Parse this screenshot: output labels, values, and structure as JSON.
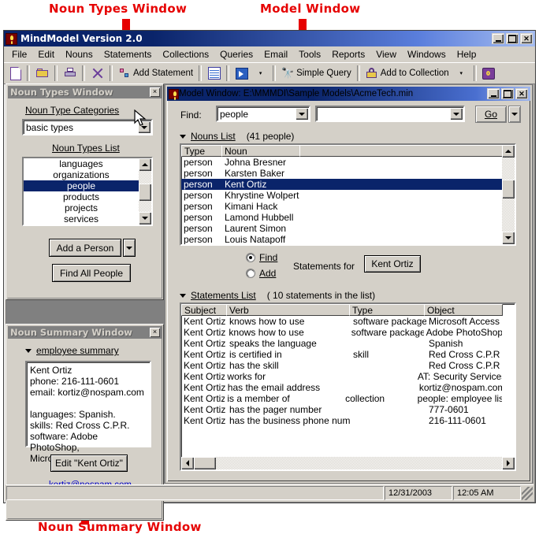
{
  "annotations": [
    {
      "text": "Noun Types Window",
      "name": "callout-noun-types-window"
    },
    {
      "text": "Model Window",
      "name": "callout-model-window"
    },
    {
      "text": "Noun Summary Window",
      "name": "callout-noun-summary-window"
    }
  ],
  "app": {
    "title": "MindModel Version 2.0",
    "minimize": "_",
    "maximize": "□",
    "close": "×",
    "menu": [
      "File",
      "Edit",
      "Nouns",
      "Statements",
      "Collections",
      "Queries",
      "Email",
      "Tools",
      "Reports",
      "View",
      "Windows",
      "Help"
    ],
    "toolbar": [
      {
        "icon": "new-document-icon",
        "label": ""
      },
      {
        "icon": "open-folder-icon",
        "label": ""
      },
      {
        "icon": "print-icon",
        "label": ""
      },
      {
        "icon": "delete-x-icon",
        "label": ""
      },
      {
        "icon": "add-statement-icon",
        "label": "Add Statement"
      },
      {
        "icon": "grid-view-icon",
        "label": ""
      },
      {
        "icon": "blue-window-icon",
        "label": "",
        "caret": "▾"
      },
      {
        "icon": "binoculars-icon",
        "label": "Simple Query"
      },
      {
        "icon": "collection-lock-icon",
        "label": "Add to Collection",
        "caret": "▾"
      },
      {
        "icon": "help-book-icon",
        "label": ""
      }
    ],
    "statusbar": {
      "message": "",
      "date": "12/31/2003",
      "time": "12:05 AM"
    }
  },
  "noun_types_window": {
    "caption": "Noun Types Window",
    "close": "×",
    "categories_label": "Noun Type Categories",
    "category_value": "basic types",
    "list_label": "Noun Types List",
    "items": [
      "languages",
      "organizations",
      "people",
      "products",
      "projects",
      "services"
    ],
    "selected_item": "people",
    "add_button": "Add a Person",
    "add_button_caret": "▾",
    "find_button": "Find All People"
  },
  "noun_summary_window": {
    "caption": "Noun Summary Window",
    "close": "×",
    "section_label": "employee summary",
    "summary_lines": [
      "Kent Ortiz",
      "phone: 216-111-0601",
      "email: kortiz@nospam.com",
      "",
      "languages: Spanish.",
      "skills: Red Cross C.P.R.",
      "software: Adobe PhotoShop,",
      "Microsoft Access."
    ],
    "edit_button": "Edit \"Kent Ortiz\"",
    "email_link": "kortiz@nospam.com"
  },
  "model_window": {
    "title": "Model Window: E:\\MMMDI\\Sample Models\\AcmeTech.min",
    "minimize": "_",
    "maximize": "□",
    "close": "×",
    "find_label": "Find:",
    "find_type_value": "people",
    "find_text_value": "",
    "go_button": "Go",
    "go_caret": "▾",
    "nouns_list": {
      "label": "Nouns List",
      "count_text": "(41 people)",
      "columns": [
        "Type",
        "Noun",
        ""
      ],
      "rows": [
        {
          "type": "person",
          "noun": "Johna Bresner",
          "selected": false
        },
        {
          "type": "person",
          "noun": "Karsten Baker",
          "selected": false
        },
        {
          "type": "person",
          "noun": "Kent Ortiz",
          "selected": true
        },
        {
          "type": "person",
          "noun": "Khrystine Wolpert",
          "selected": false
        },
        {
          "type": "person",
          "noun": "Kimani Hack",
          "selected": false
        },
        {
          "type": "person",
          "noun": "Lamond Hubbell",
          "selected": false
        },
        {
          "type": "person",
          "noun": "Laurent Simon",
          "selected": false
        },
        {
          "type": "person",
          "noun": "Louis Natapoff",
          "selected": false
        }
      ]
    },
    "mode": {
      "find_label": "Find",
      "add_label": "Add",
      "selected": "Find",
      "statements_for_label": "Statements for",
      "subject_button": "Kent Ortiz"
    },
    "statements_list": {
      "label": "Statements List",
      "count_text": "( 10 statements in the list)",
      "columns": [
        "Subject",
        "Verb",
        "Type",
        "Object"
      ],
      "rows": [
        {
          "subject": "Kent Ortiz",
          "verb": "knows how to use",
          "type": "software package",
          "object": "Microsoft Access"
        },
        {
          "subject": "Kent Ortiz",
          "verb": "knows how to use",
          "type": "software package",
          "object": "Adobe PhotoShop"
        },
        {
          "subject": "Kent Ortiz",
          "verb": "speaks the language",
          "type": "",
          "object": "Spanish"
        },
        {
          "subject": "Kent Ortiz",
          "verb": "is certified in",
          "type": "skill",
          "object": "Red Cross C.P.R"
        },
        {
          "subject": "Kent Ortiz",
          "verb": "has the skill",
          "type": "",
          "object": "Red Cross C.P.R"
        },
        {
          "subject": "Kent Ortiz",
          "verb": "works for",
          "type": "",
          "object": "AT: Security Services"
        },
        {
          "subject": "Kent Ortiz",
          "verb": "has the email address",
          "type": "",
          "object": "kortiz@nospam.com"
        },
        {
          "subject": "Kent Ortiz",
          "verb": "is a member of",
          "type": "collection",
          "object": "people: employee list"
        },
        {
          "subject": "Kent Ortiz",
          "verb": "has the pager number",
          "type": "",
          "object": "777-0601"
        },
        {
          "subject": "Kent Ortiz",
          "verb": "has the business phone number",
          "type": "",
          "object": "216-111-0601"
        }
      ]
    }
  }
}
